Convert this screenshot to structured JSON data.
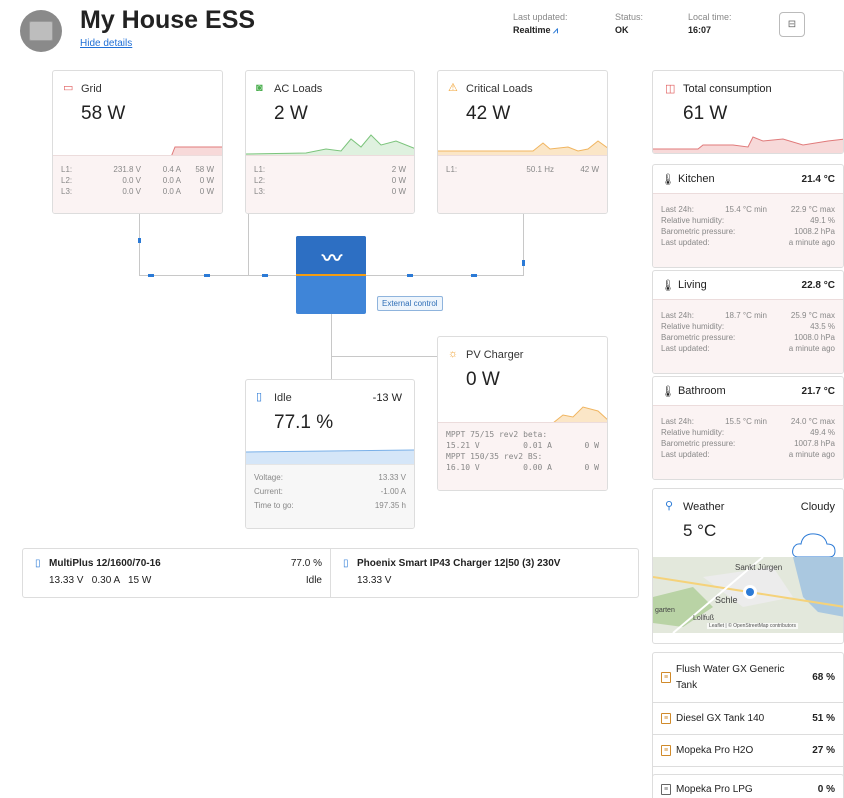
{
  "header": {
    "title": "My House ESS",
    "hide_details": "Hide details",
    "last_updated_label": "Last updated:",
    "last_updated_value": "Realtime",
    "status_label": "Status:",
    "status_value": "OK",
    "local_time_label": "Local time:",
    "local_time_value": "16:07"
  },
  "grid": {
    "title": "Grid",
    "value": "58 W",
    "rows": [
      [
        "L1:",
        "231.8 V",
        "0.4 A",
        "58 W"
      ],
      [
        "L2:",
        "0.0 V",
        "0.0 A",
        "0 W"
      ],
      [
        "L3:",
        "0.0 V",
        "0.0 A",
        "0 W"
      ]
    ]
  },
  "ac_loads": {
    "title": "AC Loads",
    "value": "2 W",
    "rows": [
      [
        "L1:",
        "2 W"
      ],
      [
        "L2:",
        "0 W"
      ],
      [
        "L3:",
        "0 W"
      ]
    ]
  },
  "critical": {
    "title": "Critical Loads",
    "value": "42 W",
    "row": [
      "L1:",
      "50.1 Hz",
      "42 W"
    ]
  },
  "inverter": {
    "external": "External control"
  },
  "pv": {
    "title": "PV Charger",
    "value": "0 W",
    "c1_name": "MPPT 75/15 rev2 beta:",
    "c1_vals": [
      "15.21 V",
      "0.01 A",
      "0 W"
    ],
    "c2_name": "MPPT 150/35 rev2 BS:",
    "c2_vals": [
      "16.10 V",
      "0.00 A",
      "0 W"
    ]
  },
  "battery": {
    "title": "Idle",
    "power": "-13 W",
    "soc": "77.1 %",
    "rows": [
      [
        "Voltage:",
        "13.33 V"
      ],
      [
        "Current:",
        "-1.00 A"
      ],
      [
        "Time to go:",
        "197.35 h"
      ]
    ]
  },
  "devices": {
    "d1_name": "MultiPlus 12/1600/70-16",
    "d1_pct": "77.0 %",
    "d1_vals": "13.33 V   0.30 A   15 W",
    "d1_state": "Idle",
    "d2_name": "Phoenix Smart IP43 Charger 12|50 (3) 230V",
    "d2_vals": "13.33 V"
  },
  "total": {
    "title": "Total consumption",
    "value": "61 W"
  },
  "sensors": [
    {
      "name": "Kitchen",
      "temp": "21.4 °C",
      "min": "15.4 °C min",
      "max": "22.9 °C max",
      "hum": "49.1 %",
      "press": "1008.2 hPa",
      "upd": "a minute ago"
    },
    {
      "name": "Living",
      "temp": "22.8 °C",
      "min": "18.7 °C min",
      "max": "25.9 °C max",
      "hum": "43.5 %",
      "press": "1008.0 hPa",
      "upd": "a minute ago"
    },
    {
      "name": "Bathroom",
      "temp": "21.7 °C",
      "min": "15.5 °C min",
      "max": "24.0 °C max",
      "hum": "49.4 %",
      "press": "1007.8 hPa",
      "upd": "a minute ago"
    }
  ],
  "sensor_labels": {
    "last24": "Last 24h:",
    "hum": "Relative humidity:",
    "press": "Barometric pressure:",
    "upd": "Last updated:"
  },
  "weather": {
    "title": "Weather",
    "cond": "Cloudy",
    "temp": "5 °C",
    "map_town1": "Sankt Jürgen",
    "map_town2": "Schle",
    "map_town3": "Lollfuß",
    "map_left": "garten",
    "attribution": "Leaflet | © OpenStreetMap contributors"
  },
  "tanks": [
    {
      "name": "Flush Water GX Generic Tank",
      "value": "68 %"
    },
    {
      "name": "Diesel GX Tank 140",
      "value": "51 %"
    },
    {
      "name": "Mopeka Pro H2O",
      "value": "27 %"
    },
    {
      "name": "Mopeka Pro LPG",
      "value": "0 %"
    }
  ],
  "colors": {
    "grid": "#e05a5a",
    "ac": "#4caf50",
    "critical": "#f0a030",
    "blue": "#2b7ad6"
  }
}
